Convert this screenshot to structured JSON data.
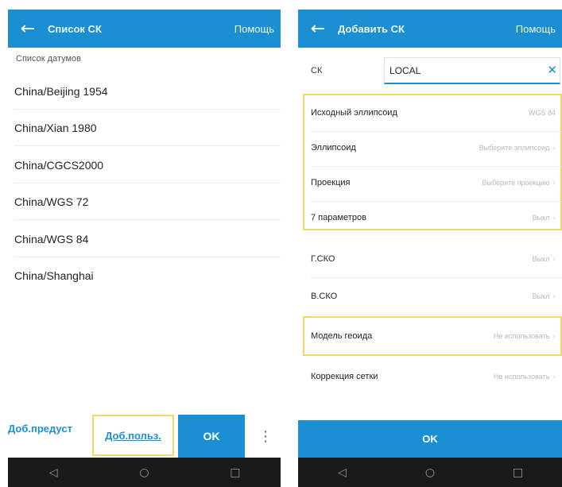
{
  "left": {
    "appbar": {
      "back_icon": "arrow-left-icon",
      "title": "Список СК",
      "help": "Помощь"
    },
    "section_label": "Список датумов",
    "items": [
      {
        "label": "China/Beijing 1954"
      },
      {
        "label": "China/Xian 1980"
      },
      {
        "label": "China/CGCS2000"
      },
      {
        "label": "China/WGS 72"
      },
      {
        "label": "China/WGS 84"
      },
      {
        "label": "China/Shanghai"
      }
    ],
    "bottom": {
      "preset": "Доб.предуст",
      "field": "Доб.польз.",
      "ok": "OK",
      "more": "⋮"
    }
  },
  "right": {
    "appbar": {
      "back_icon": "arrow-left-icon",
      "title": "Добавить СК",
      "help": "Помощь"
    },
    "ck": {
      "label": "СК",
      "value": "LOCAL",
      "clear_icon": "close-icon"
    },
    "rows": [
      {
        "label": "Исходный эллипсоид",
        "value": "WGS 84",
        "chevron": false
      },
      {
        "label": "Эллипсоид",
        "value": "Выберите эллипсоид",
        "chevron": true
      },
      {
        "label": "Проекция",
        "value": "Выберите проекцию",
        "chevron": true
      },
      {
        "label": "7 параметров",
        "value": "Выкл",
        "chevron": true
      },
      {
        "label": "Г.СКО",
        "value": "Выкл",
        "chevron": true
      },
      {
        "label": "В.СКО",
        "value": "Выкл",
        "chevron": true
      },
      {
        "label": "Модель геоида",
        "value": "Не использовать",
        "chevron": true
      },
      {
        "label": "Коррекция сетки",
        "value": "Не использовать",
        "chevron": true
      }
    ],
    "ok": "OK"
  },
  "navbar": {
    "back": "◁",
    "home": "○",
    "recent": "□"
  },
  "colors": {
    "accent": "#1c8fd3",
    "highlight": "#f0d76a",
    "navbar": "#1a1a1a"
  }
}
